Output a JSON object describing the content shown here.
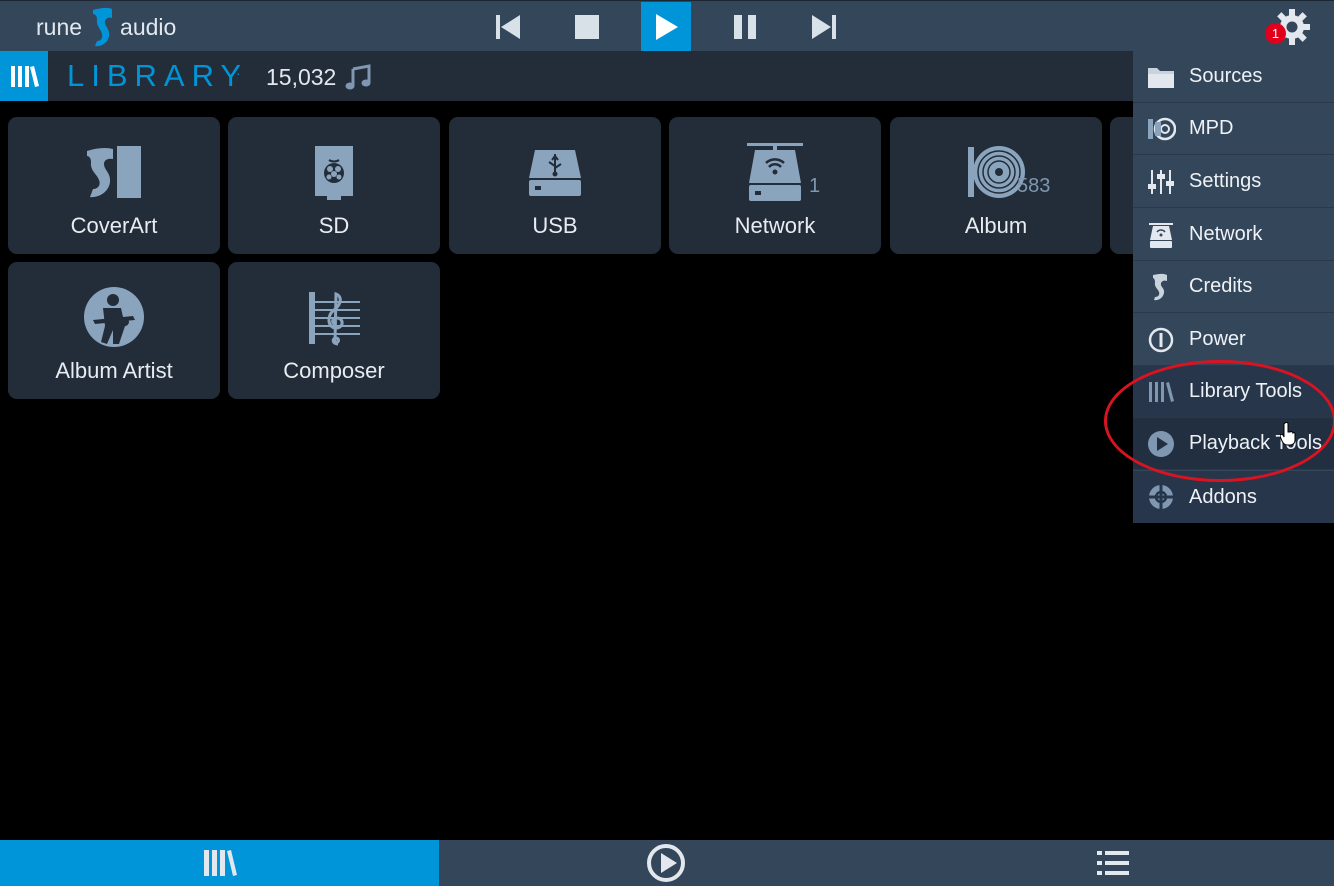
{
  "app": {
    "name_left": "rune",
    "name_right": "audio"
  },
  "transport": {
    "buttons": [
      "previous",
      "stop",
      "play",
      "pause",
      "next"
    ],
    "active": "play",
    "accent": "#0095d8"
  },
  "settings": {
    "badge": "1"
  },
  "library": {
    "title": "LIBRARY",
    "dot": "·",
    "count": "15,032"
  },
  "tiles": [
    {
      "label": "CoverArt",
      "icon": "coverart-icon",
      "count": ""
    },
    {
      "label": "SD",
      "icon": "sd-card-icon",
      "count": ""
    },
    {
      "label": "USB",
      "icon": "usb-drive-icon",
      "count": ""
    },
    {
      "label": "Network",
      "icon": "network-drive-icon",
      "count": "1"
    },
    {
      "label": "Album",
      "icon": "album-icon",
      "count": "583"
    },
    {
      "label": "Album Artist",
      "icon": "album-artist-icon",
      "count": ""
    },
    {
      "label": "Composer",
      "icon": "composer-icon",
      "count": ""
    }
  ],
  "menu": {
    "items": [
      {
        "label": "Sources",
        "icon": "folder-icon"
      },
      {
        "label": "MPD",
        "icon": "mpd-icon"
      },
      {
        "label": "Settings",
        "icon": "sliders-icon"
      },
      {
        "label": "Network",
        "icon": "network-icon"
      },
      {
        "label": "Credits",
        "icon": "rune-logo-icon"
      },
      {
        "label": "Power",
        "icon": "power-icon"
      },
      {
        "label": "Library Tools",
        "icon": "library-icon"
      },
      {
        "label": "Playback Tools",
        "icon": "play-circle-icon"
      },
      {
        "label": "Addons",
        "icon": "addons-icon"
      }
    ]
  },
  "bottom": {
    "tabs": [
      "library",
      "playback",
      "playlist"
    ],
    "active": "library"
  },
  "colors": {
    "topbar": "#34465a",
    "panel": "#222d39",
    "accent": "#0095d8",
    "badge": "#e0001b",
    "highlight": "#d91422"
  }
}
